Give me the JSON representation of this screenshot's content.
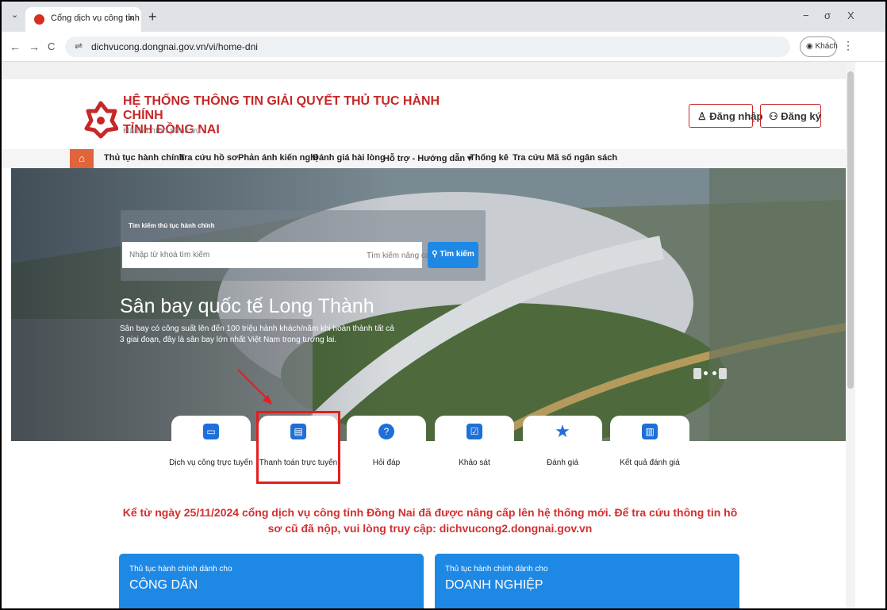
{
  "browser": {
    "tab_title": "Cổng dịch vụ công tỉnh Đồng N",
    "url": "dichvucong.dongnai.gov.vn/vi/home-dni",
    "profile_label": "Khách",
    "tab_menu_icon": "chevron-down-icon",
    "new_tab_label": "+",
    "tab_close_label": "×",
    "back_label": "←",
    "forward_label": "→",
    "reload_label": "C",
    "minimize_label": "−",
    "restore_label": "σ",
    "close_label": "X",
    "menu_label": "⋮"
  },
  "header": {
    "title_line1": "HỆ THỐNG THÔNG TIN GIẢI QUYẾT THỦ TỤC HÀNH CHÍNH",
    "title_line2": "TỈNH ĐỒNG NAI",
    "subtitle": "Hành chính phục vụ",
    "login_label": "Đăng nhập",
    "register_label": "Đăng ký"
  },
  "menu": {
    "items": [
      "Thủ tục hành chính",
      "Tra cứu hồ sơ",
      "Phản ánh kiến nghị",
      "Đánh giá hài lòng",
      "Hỗ trợ - Hướng dẫn ▾",
      "Thống kê",
      "Tra cứu Mã số ngân sách"
    ]
  },
  "search": {
    "label": "Tìm kiếm thủ tục hành chính",
    "placeholder": "Nhập từ khoá tìm kiếm",
    "advanced_label": "Tìm kiếm nâng cao",
    "button_label": "Tìm kiếm"
  },
  "banner": {
    "title": "Sân bay quốc tế Long Thành",
    "description": "Sân bay có công suất lên đến 100 triệu hành khách/năm khi hoàn thành tất cả 3 giai đoạn, đây là sân bay lớn nhất Việt Nam trong tương lai."
  },
  "services": [
    {
      "label": "Dịch vụ công trực tuyến",
      "icon": "monitor-icon"
    },
    {
      "label": "Thanh toán trực tuyến",
      "icon": "payment-card-icon"
    },
    {
      "label": "Hỏi đáp",
      "icon": "question-icon"
    },
    {
      "label": "Khảo sát",
      "icon": "checklist-icon"
    },
    {
      "label": "Đánh giá",
      "icon": "star-icon"
    },
    {
      "label": "Kết quả đánh giá",
      "icon": "book-icon"
    }
  ],
  "notice": "Kể từ ngày 25/11/2024 cổng dịch vụ công tỉnh Đồng Nai đã được nâng cấp lên hệ thống mới. Để tra cứu thông tin hồ sơ cũ đã nộp, vui lòng truy cập: dichvucong2.dongnai.gov.vn",
  "categories": [
    {
      "small": "Thủ tục hành chính dành cho",
      "big": "CÔNG DÂN"
    },
    {
      "small": "Thủ tục hành chính dành cho",
      "big": "DOANH NGHIỆP"
    }
  ],
  "colors": {
    "brand_red": "#c62828",
    "primary_blue": "#1e88e5",
    "highlight_red": "#e41e1e"
  }
}
